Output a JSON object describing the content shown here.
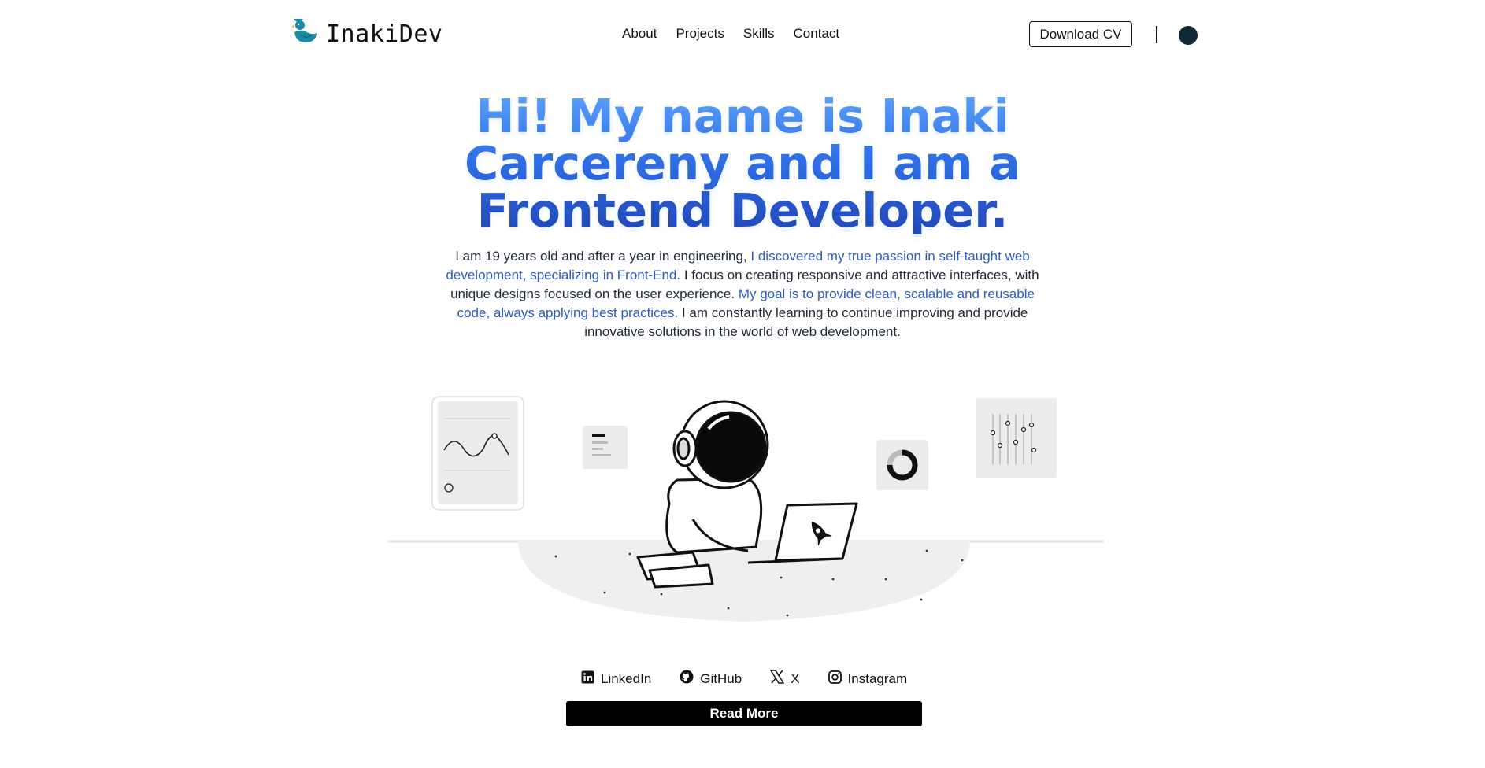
{
  "header": {
    "logo_text": "InakiDev",
    "logo_icon": "duck-icon",
    "nav": [
      {
        "label": "About"
      },
      {
        "label": "Projects"
      },
      {
        "label": "Skills"
      },
      {
        "label": "Contact"
      }
    ],
    "download_cv_label": "Download CV",
    "theme_toggle_icon": "moon-icon"
  },
  "hero": {
    "title": "Hi! My name is Inaki Carcereny and I am a Frontend Developer.",
    "description": {
      "p1": "I am 19 years old and after a year in engineering, ",
      "h1": "I discovered my true passion in self-taught web development, specializing in Front-End.",
      "p2": " I focus on creating responsive and attractive interfaces, with unique designs focused on the user experience. ",
      "h2": "My goal is to provide clean, scalable and reusable code, always applying best practices.",
      "p3": " I am constantly learning to continue improving and provide innovative solutions in the world of web development."
    },
    "illustration_icon": "astronaut-laptop-illustration"
  },
  "social": [
    {
      "label": "LinkedIn",
      "icon": "linkedin-icon"
    },
    {
      "label": "GitHub",
      "icon": "github-icon"
    },
    {
      "label": "X",
      "icon": "x-icon"
    },
    {
      "label": "Instagram",
      "icon": "instagram-icon"
    }
  ],
  "read_more_label": "Read More",
  "colors": {
    "accent": "#2b5cc4",
    "title_gradient_top": "#60a5fa",
    "title_gradient_bottom": "#1e40af",
    "logo_duck": "#1a8ca3"
  }
}
